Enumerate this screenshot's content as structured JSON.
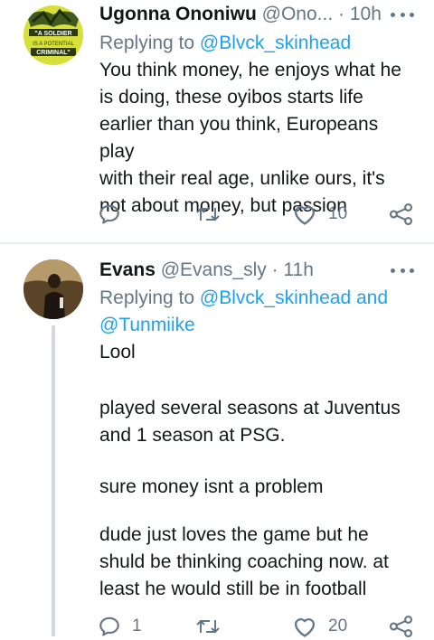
{
  "tweets": [
    {
      "name": "Ugonna Ononiwu",
      "handle_time": "@Ono... · 10h",
      "reply_prefix": "Replying to",
      "reply_to": "@Blvck_skinhead",
      "reply_to_line2": "",
      "text": "You think money, he enjoys what he\nis doing, these oyibos starts life\nearlier than you think, Europeans play\nwith their real age, unlike ours, it's\nnot about money, but passion",
      "avatar_caption": [
        "\"A SOLDIER",
        "IS A POTENTIAL",
        "CRIMINAL\""
      ],
      "counts": {
        "replies": "",
        "retweets": "",
        "likes": "10"
      }
    },
    {
      "name": "Evans",
      "handle_time": "@Evans_sly · 11h",
      "reply_prefix": "Replying to",
      "reply_to": "@Blvck_skinhead and",
      "reply_to_line2": "@Tunmiike",
      "paragraphs": [
        "Lool",
        "played several seasons at Juventus\nand 1 season at PSG.",
        "sure money isnt a problem",
        "dude just loves the game but he\nshuld be thinking coaching now. at\nleast he would still be in football"
      ],
      "counts": {
        "replies": "1",
        "retweets": "",
        "likes": "20"
      }
    }
  ],
  "icons": {
    "reply": "reply-icon",
    "retweet": "retweet-icon",
    "like": "heart-icon",
    "share": "share-icon",
    "more": "more-options-icon"
  },
  "colors": {
    "text": "#14171a",
    "muted": "#657786",
    "link": "#1da1f2",
    "divider": "#e6ecf0",
    "thread_line": "#cfd9de"
  }
}
